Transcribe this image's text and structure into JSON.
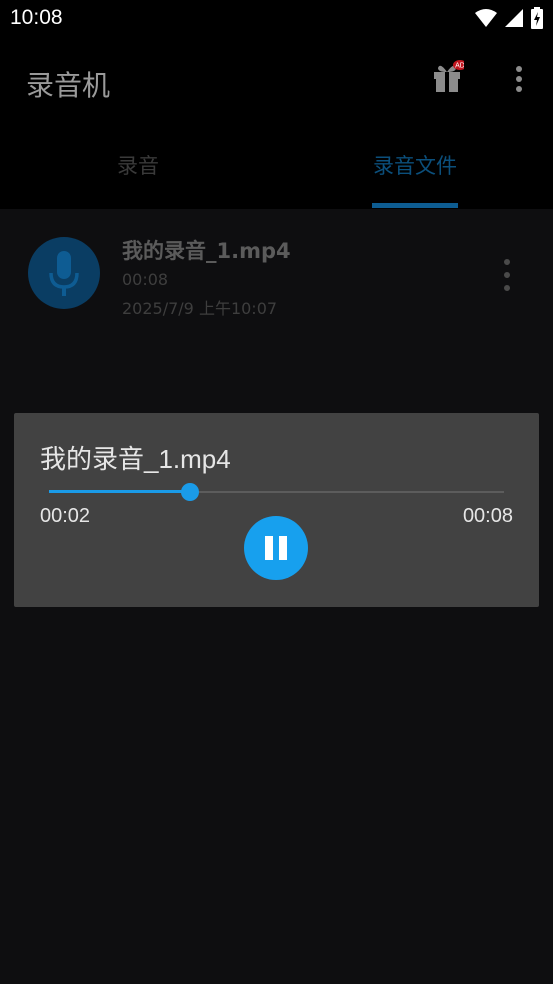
{
  "status_bar": {
    "time": "10:08"
  },
  "app_bar": {
    "title": "录音机",
    "ad_badge": "AD"
  },
  "tabs": [
    {
      "label": "录音",
      "selected": false
    },
    {
      "label": "录音文件",
      "selected": true
    }
  ],
  "recordings": [
    {
      "name": "我的录音_1.mp4",
      "duration": "00:08",
      "date": "2025/7/9 上午10:07"
    }
  ],
  "player": {
    "title": "我的录音_1.mp4",
    "current_time": "00:02",
    "total_time": "00:08",
    "progress": 0.31,
    "state": "playing"
  },
  "colors": {
    "accent": "#1a9be8",
    "player_bg": "#424242",
    "tab_selected": "#0b4f7c"
  }
}
